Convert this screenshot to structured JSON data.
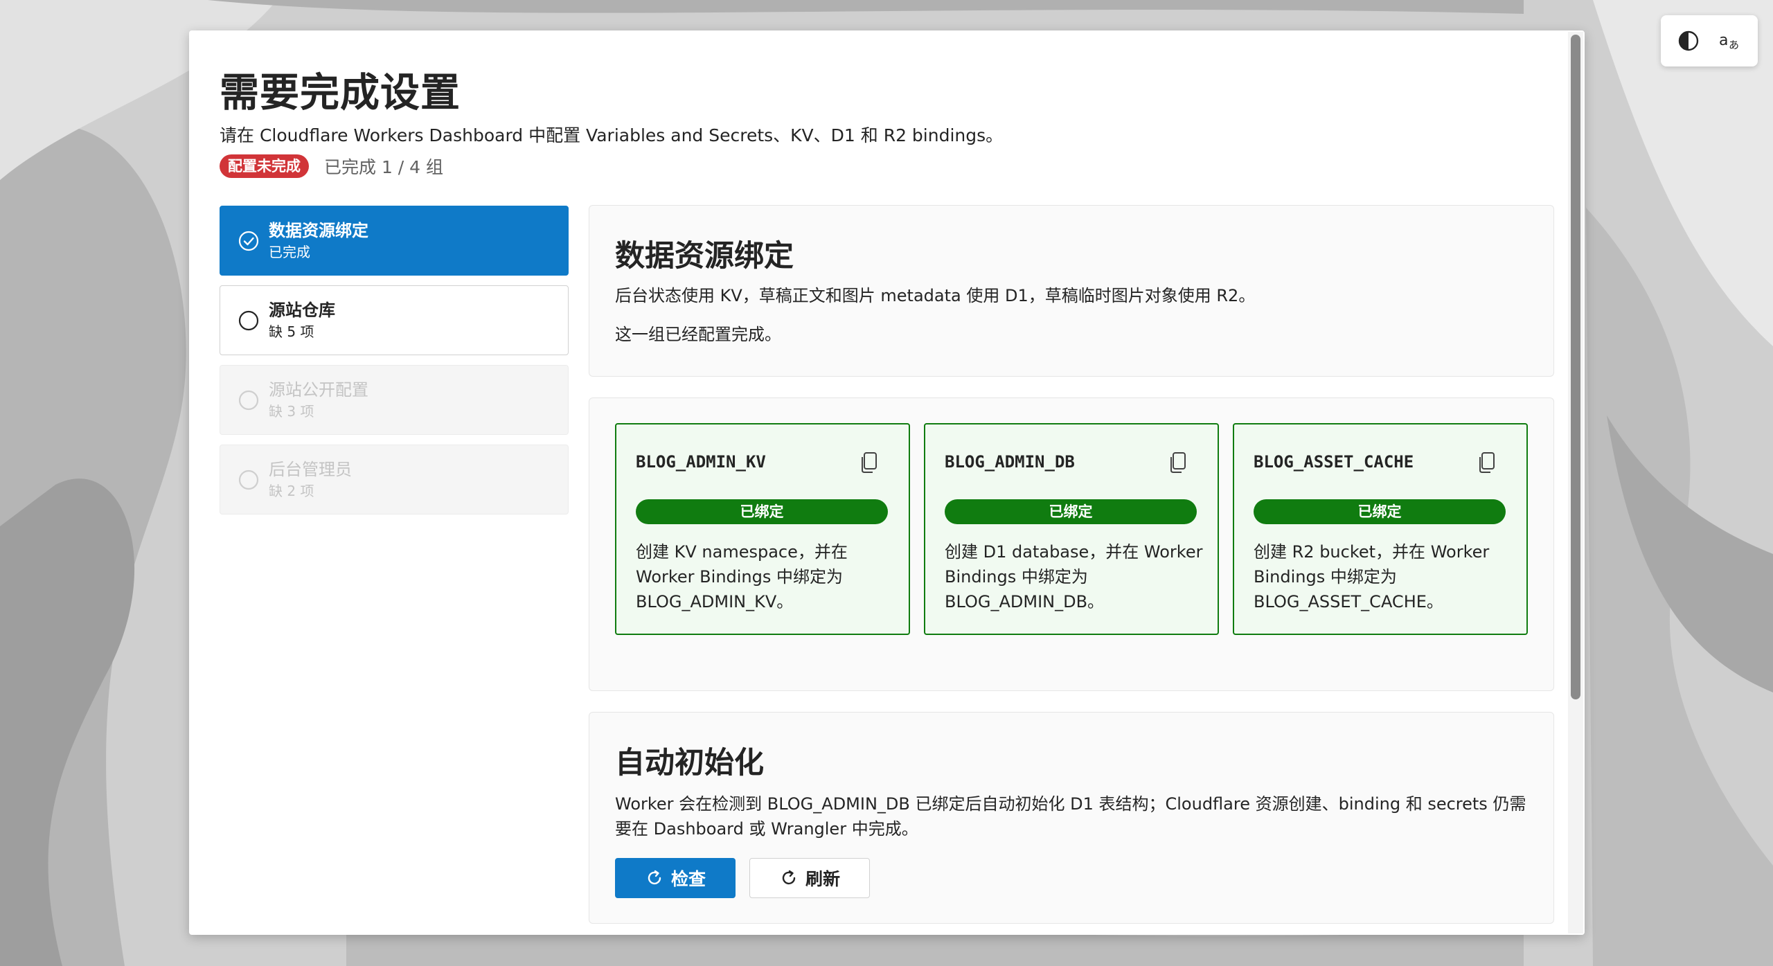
{
  "header": {
    "title": "需要完成设置",
    "description": "请在 Cloudflare Workers Dashboard 中配置 Variables and Secrets、KV、D1 和 R2 bindings。",
    "status_badge": "配置未完成",
    "progress": "已完成 1 / 4 组"
  },
  "toolbar": {
    "theme_icon": "contrast-icon",
    "language_icon": "translate-icon"
  },
  "nav": {
    "items": [
      {
        "title": "数据资源绑定",
        "sub": "已完成",
        "state": "active"
      },
      {
        "title": "源站仓库",
        "sub": "缺 5 项",
        "state": "default"
      },
      {
        "title": "源站公开配置",
        "sub": "缺 3 项",
        "state": "disabled"
      },
      {
        "title": "后台管理员",
        "sub": "缺 2 项",
        "state": "disabled"
      }
    ]
  },
  "section_resources": {
    "title": "数据资源绑定",
    "line1": "后台状态使用 KV，草稿正文和图片 metadata 使用 D1，草稿临时图片对象使用 R2。",
    "line2": "这一组已经配置完成。"
  },
  "bindings": [
    {
      "name": "BLOG_ADMIN_KV",
      "status": "已绑定",
      "desc": "创建 KV namespace，并在 Worker Bindings 中绑定为 BLOG_ADMIN_KV。"
    },
    {
      "name": "BLOG_ADMIN_DB",
      "status": "已绑定",
      "desc": "创建 D1 database，并在 Worker Bindings 中绑定为 BLOG_ADMIN_DB。"
    },
    {
      "name": "BLOG_ASSET_CACHE",
      "status": "已绑定",
      "desc": "创建 R2 bucket，并在 Worker Bindings 中绑定为 BLOG_ASSET_CACHE。"
    }
  ],
  "section_init": {
    "title": "自动初始化",
    "description": "Worker 会在检测到 BLOG_ADMIN_DB 已绑定后自动初始化 D1 表结构；Cloudflare 资源创建、binding 和 secrets 仍需要在 Dashboard 或 Wrangler 中完成。",
    "check_label": "检查",
    "refresh_label": "刷新"
  },
  "colors": {
    "accent": "#0f7ac8",
    "success": "#107c10",
    "danger": "#d13438"
  }
}
